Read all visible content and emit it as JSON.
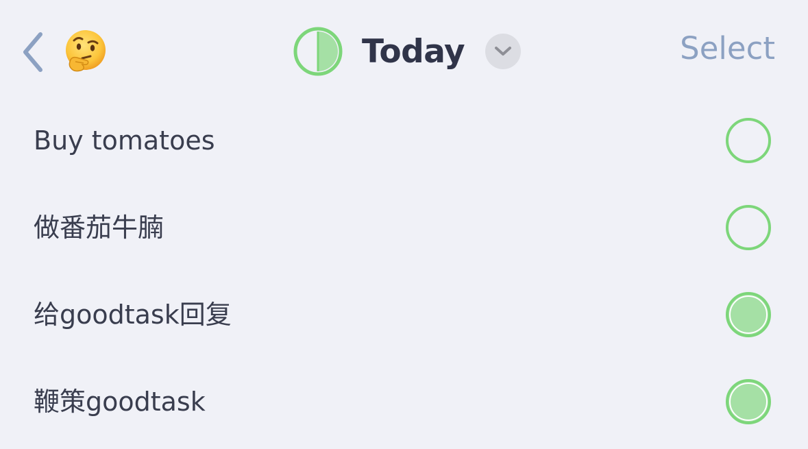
{
  "nav": {
    "back_icon": "chevron-left-icon",
    "emoji_icon": "thinking-face-emoji",
    "title": "Today",
    "progress_icon": "half-filled-circle-icon",
    "dropdown_icon": "chevron-down-icon",
    "select_label": "Select"
  },
  "tasks": [
    {
      "title": "Buy tomatoes",
      "completed": false
    },
    {
      "title": "做番茄牛腩",
      "completed": false
    },
    {
      "title": "给goodtask回复",
      "completed": true
    },
    {
      "title": "鞭策goodtask",
      "completed": true
    }
  ],
  "colors": {
    "background": "#f0f1f7",
    "accent_green": "#7dd67a",
    "green_fill": "#a5e0a5",
    "back_chevron": "#8ca1c2",
    "select_text": "#8ca1c2",
    "title_text": "#303449",
    "task_text": "#393d4e",
    "dropdown_bg": "#dcdde3",
    "dropdown_chevron": "#8e8f96"
  },
  "progress": {
    "completed": 2,
    "total": 4
  }
}
